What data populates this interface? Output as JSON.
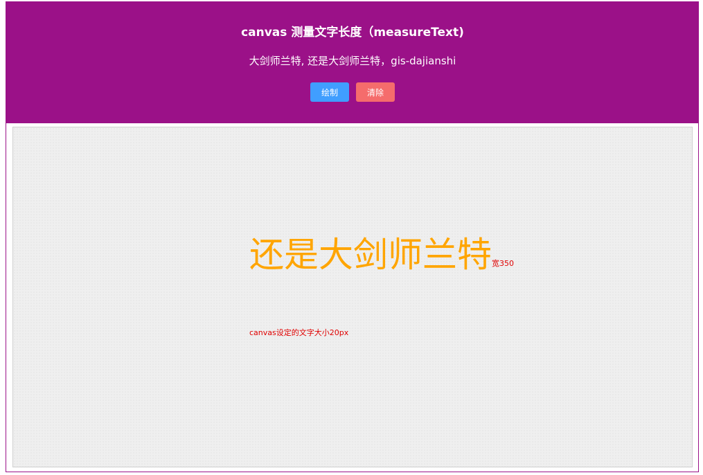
{
  "header": {
    "title": "canvas 测量文字长度（measureText)",
    "subtitle": "大剑师兰特, 还是大剑师兰特，gis-dajianshi",
    "draw_label": "绘制",
    "clear_label": "清除"
  },
  "canvas": {
    "text": "还是大剑师兰特",
    "width_label": "宽350",
    "size_note": "canvas设定的文字大小20px"
  },
  "colors": {
    "header_bg": "#9b1188",
    "draw_button": "#409eff",
    "clear_button": "#f56c6c",
    "canvas_text": "#ffa500",
    "annotation_text": "#e00000"
  }
}
